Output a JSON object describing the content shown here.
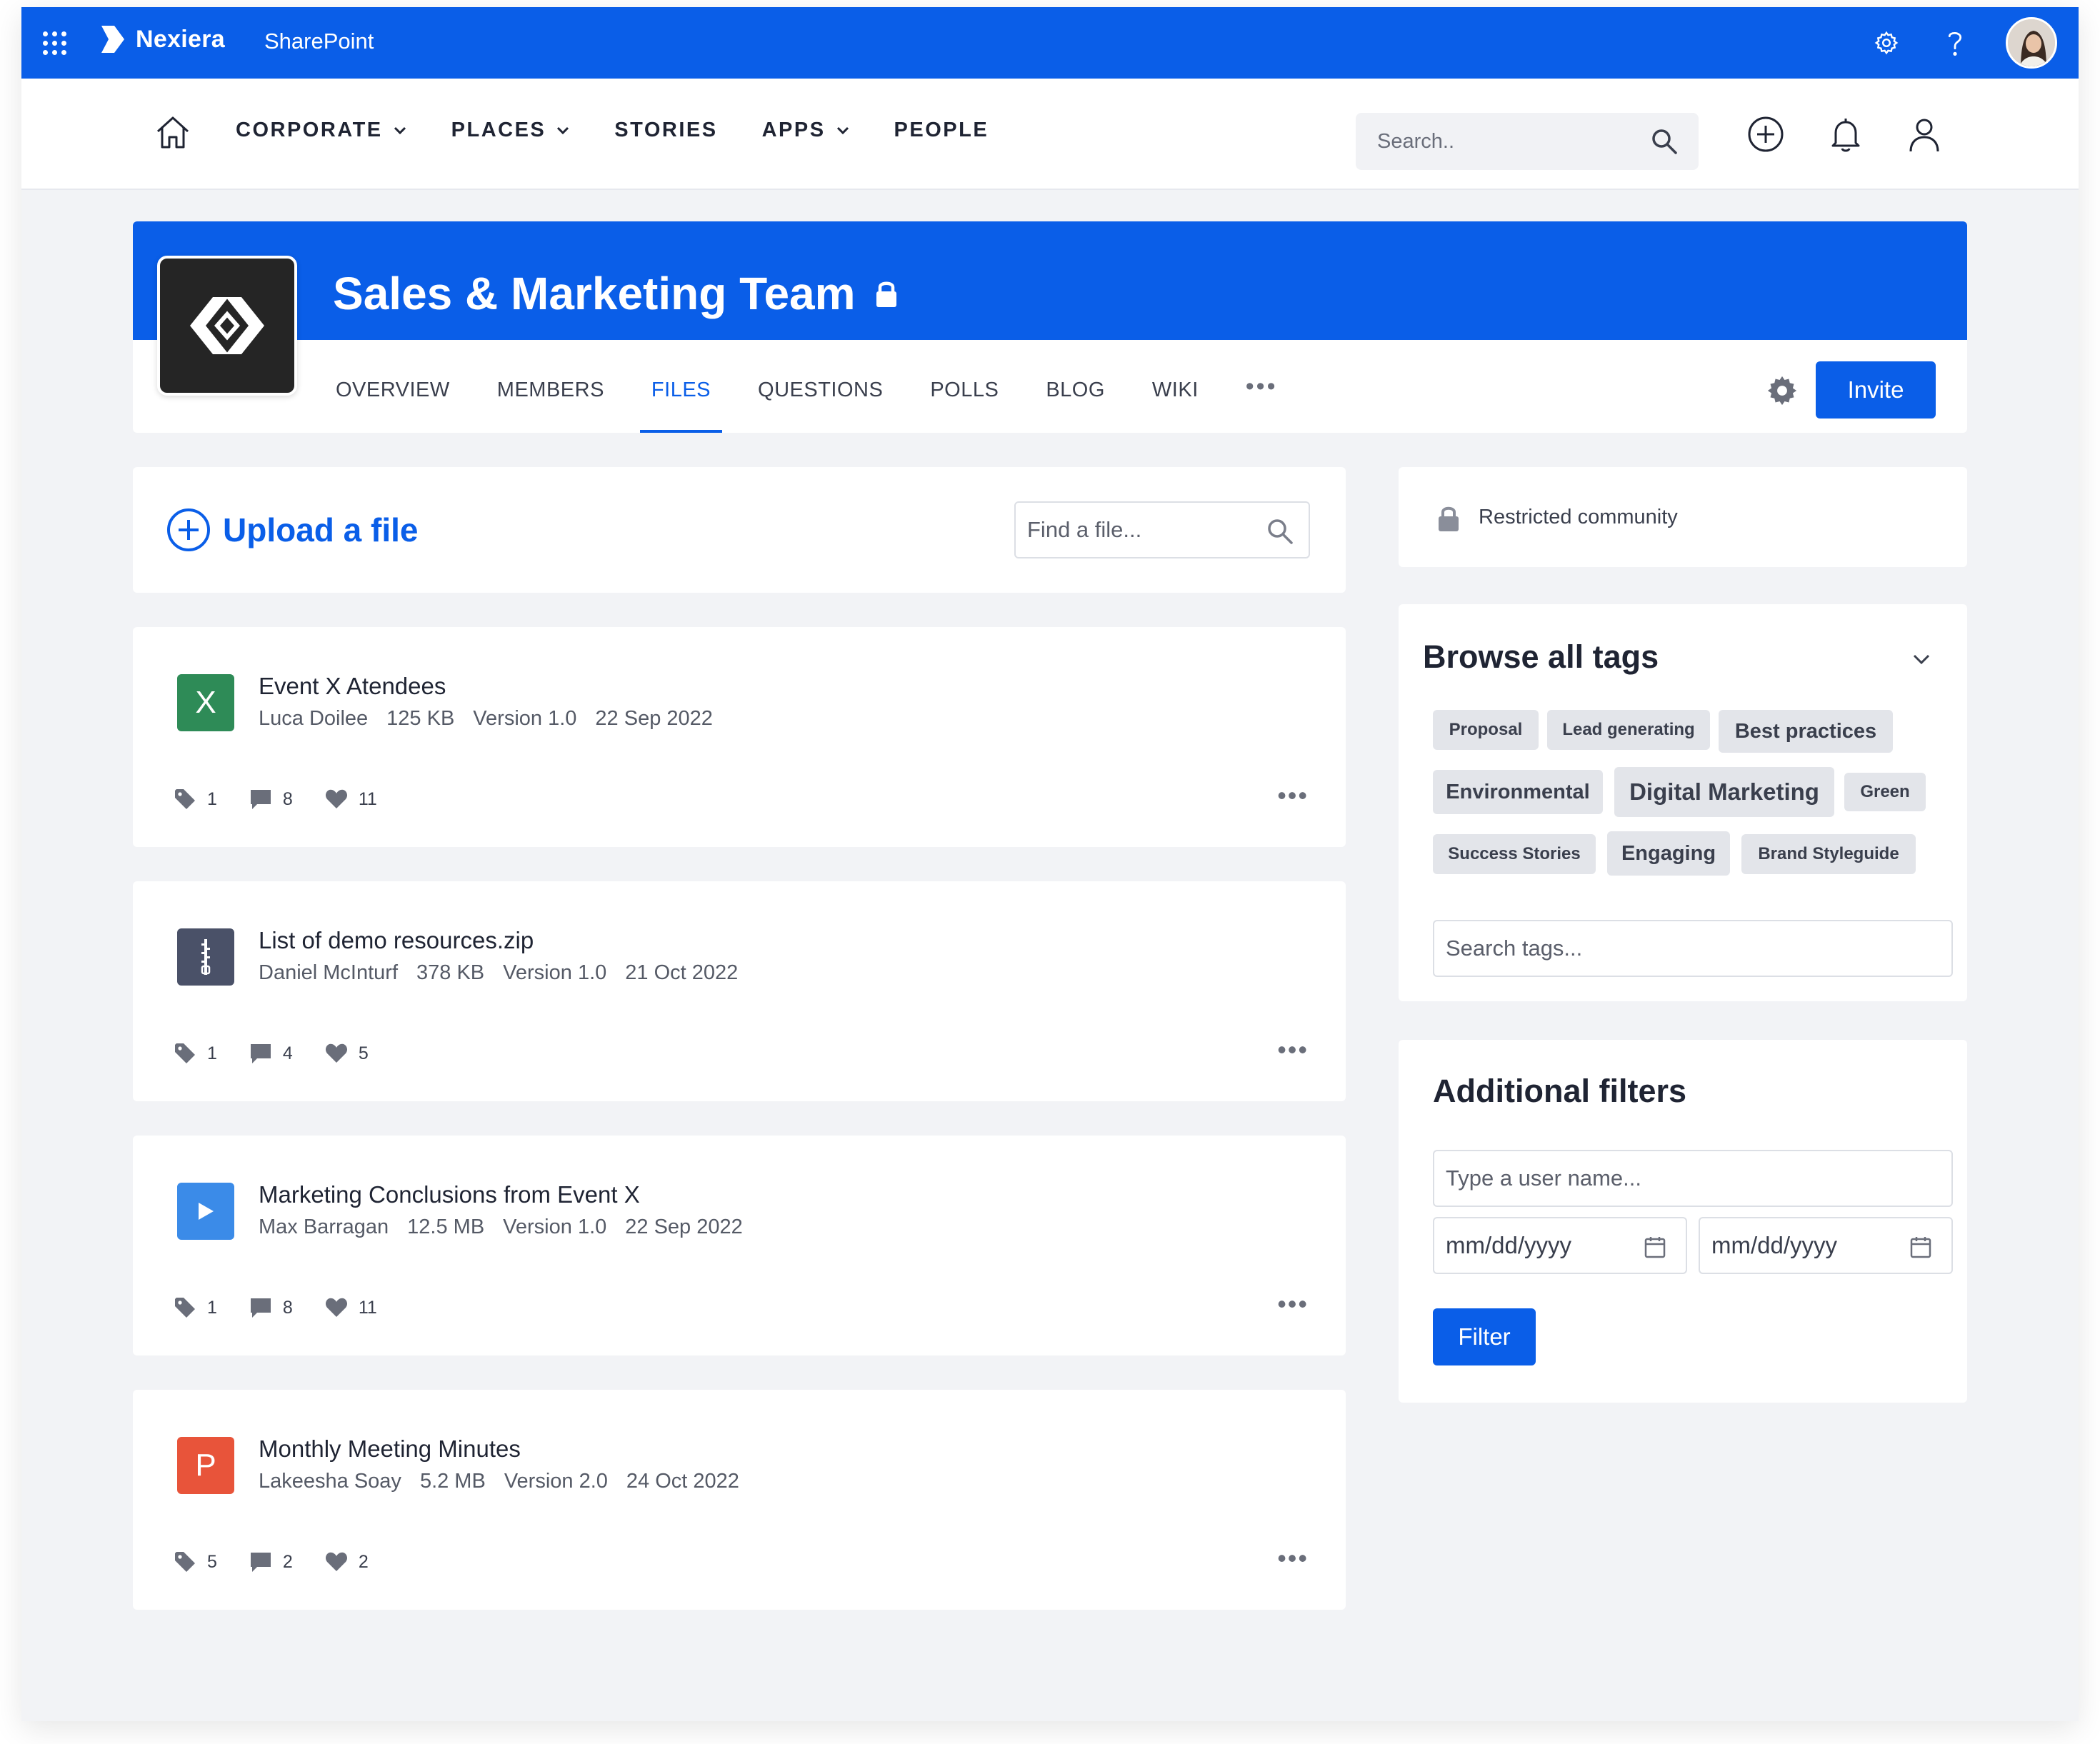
{
  "suitebar": {
    "brand_name": "Nexiera",
    "app_name": "SharePoint",
    "colors": {
      "primary": "#0a5ee8"
    }
  },
  "mainnav": {
    "items": [
      {
        "label": "CORPORATE",
        "has_dropdown": true
      },
      {
        "label": "PLACES",
        "has_dropdown": true
      },
      {
        "label": "STORIES",
        "has_dropdown": false
      },
      {
        "label": "APPS",
        "has_dropdown": true
      },
      {
        "label": "PEOPLE",
        "has_dropdown": false
      }
    ],
    "search_placeholder": "Search.."
  },
  "community": {
    "title": "Sales & Marketing Team",
    "tabs": [
      "OVERVIEW",
      "MEMBERS",
      "FILES",
      "QUESTIONS",
      "POLLS",
      "BLOG",
      "WIKI"
    ],
    "active_tab": "FILES",
    "more_glyph": "•••",
    "invite_label": "Invite"
  },
  "files": {
    "upload_label": "Upload a file",
    "find_placeholder": "Find a file...",
    "more_glyph": "•••",
    "items": [
      {
        "icon_letter": "X",
        "icon_type": "excel-icon",
        "icon_color": "#2e8b57",
        "name": "Event X Atendees",
        "author": "Luca Doilee",
        "size": "125 KB",
        "version": "Version 1.0",
        "date": "22 Sep 2022",
        "tags": "1",
        "comments": "8",
        "likes": "11"
      },
      {
        "icon_letter": "",
        "icon_type": "zip-icon",
        "icon_color": "#4a5168",
        "name": "List of demo resources.zip",
        "author": "Daniel McInturf",
        "size": "378 KB",
        "version": "Version 1.0",
        "date": "21 Oct 2022",
        "tags": "1",
        "comments": "4",
        "likes": "5"
      },
      {
        "icon_letter": "",
        "icon_type": "video-play-icon",
        "icon_color": "#3b8be8",
        "name": "Marketing Conclusions from Event X",
        "author": "Max Barragan",
        "size": "12.5 MB",
        "version": "Version 1.0",
        "date": "22 Sep 2022",
        "tags": "1",
        "comments": "8",
        "likes": "11"
      },
      {
        "icon_letter": "P",
        "icon_type": "powerpoint-icon",
        "icon_color": "#e8543a",
        "name": "Monthly Meeting Minutes",
        "author": "Lakeesha Soay",
        "size": "5.2 MB",
        "version": "Version 2.0",
        "date": "24 Oct 2022",
        "tags": "5",
        "comments": "2",
        "likes": "2"
      }
    ]
  },
  "sidebar": {
    "restricted_label": "Restricted community",
    "tags_title": "Browse all tags",
    "tags": [
      {
        "label": "Proposal",
        "size": "sm"
      },
      {
        "label": "Lead generating",
        "size": "sm"
      },
      {
        "label": "Best practices",
        "size": "md"
      },
      {
        "label": "Environmental",
        "size": "md"
      },
      {
        "label": "Digital Marketing",
        "size": "lg"
      },
      {
        "label": "Green",
        "size": "sm"
      },
      {
        "label": "Success Stories",
        "size": "sm"
      },
      {
        "label": "Engaging",
        "size": "md"
      },
      {
        "label": "Brand Styleguide",
        "size": "sm"
      }
    ],
    "tags_search_placeholder": "Search tags...",
    "filters_title": "Additional filters",
    "user_placeholder": "Type a user name...",
    "date_from": "mm/dd/yyyy",
    "date_to": "mm/dd/yyyy",
    "filter_label": "Filter"
  }
}
